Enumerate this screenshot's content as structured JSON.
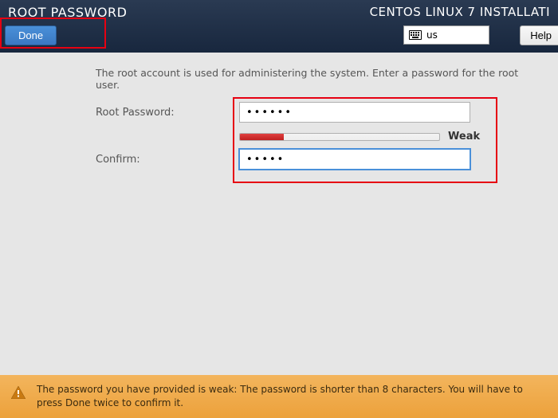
{
  "header": {
    "page_title": "ROOT PASSWORD",
    "installer_title": "CENTOS LINUX 7 INSTALLATI",
    "done_label": "Done",
    "help_label": "Help",
    "keyboard_layout": "us"
  },
  "main": {
    "instruction": "The root account is used for administering the system.  Enter a password for the root user.",
    "root_pw_label": "Root Password:",
    "confirm_label": "Confirm:",
    "root_pw_value": "······",
    "confirm_value": "·····",
    "strength_label": "Weak"
  },
  "warning": {
    "text": "The password you have provided is weak: The password is shorter than 8 characters. You will have to press Done twice to confirm it."
  }
}
